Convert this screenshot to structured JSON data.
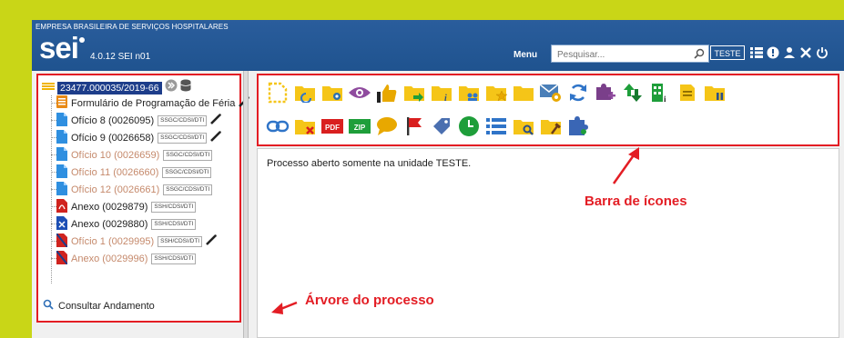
{
  "header": {
    "org": "EMPRESA BRASILEIRA DE SERVIÇOS HOSPITALARES",
    "logo": "sei",
    "version": "4.0.12 SEI n01",
    "menu_label": "Menu",
    "search_placeholder": "Pesquisar...",
    "unit": "TESTE",
    "icons": [
      "list-icon",
      "info-icon",
      "user-icon",
      "tools-icon",
      "power-icon"
    ]
  },
  "tree": {
    "process_number": "23477.000035/2019-66",
    "items": [
      {
        "label": "Formulário de Programação de Féria",
        "unit": "",
        "icon": "form-icon",
        "muted": false,
        "pen": true
      },
      {
        "label": "Ofício 8 (0026095)",
        "unit": "SSGC/CDSI/DTI",
        "icon": "document-icon",
        "muted": false,
        "pen": true
      },
      {
        "label": "Ofício 9 (0026658)",
        "unit": "SSGC/CDSI/DTI",
        "icon": "document-icon",
        "muted": false,
        "pen": true
      },
      {
        "label": "Ofício 10 (0026659)",
        "unit": "SSGC/CDSI/DTI",
        "icon": "document-icon",
        "muted": true,
        "pen": false
      },
      {
        "label": "Ofício 11 (0026660)",
        "unit": "SSGC/CDSI/DTI",
        "icon": "document-icon",
        "muted": true,
        "pen": false
      },
      {
        "label": "Ofício 12 (0026661)",
        "unit": "SSGC/CDSI/DTI",
        "icon": "document-icon",
        "muted": true,
        "pen": false
      },
      {
        "label": "Anexo (0029879)",
        "unit": "SSH/CDSI/DTI",
        "icon": "pdf-icon",
        "muted": false,
        "pen": false
      },
      {
        "label": "Anexo (0029880)",
        "unit": "SSH/CDSI/DTI",
        "icon": "excel-icon",
        "muted": false,
        "pen": false
      },
      {
        "label": "Ofício 1 (0029995)",
        "unit": "SSH/CDSI/DTI",
        "icon": "cancelled-document-icon",
        "muted": true,
        "pen": true
      },
      {
        "label": "Anexo (0029996)",
        "unit": "SSH/CDSI/DTI",
        "icon": "cancelled-document-icon",
        "muted": true,
        "pen": false
      }
    ],
    "consult_label": "Consultar Andamento"
  },
  "toolbar": {
    "row1": [
      "new-document-icon",
      "reopen-icon",
      "folder-settings-icon",
      "view-icon",
      "assign-icon",
      "send-icon",
      "update-icon",
      "share-icon",
      "bookmark-icon",
      "folder-icon",
      "email-icon",
      "refresh-icon",
      "attach-icon",
      "relate-icon",
      "building-icon",
      "note-icon",
      "pause-icon"
    ],
    "row2": [
      "link-icon",
      "delete-icon",
      "pdf-icon",
      "zip-icon",
      "comment-icon",
      "flag-icon",
      "tag-icon",
      "clock-icon",
      "list-icon",
      "search-folder-icon",
      "assign-folder-icon",
      "puzzle-icon"
    ]
  },
  "content": {
    "message": "Processo aberto somente na unidade TESTE."
  },
  "annotations": {
    "toolbar": "Barra de ícones",
    "tree": "Árvore do processo"
  }
}
